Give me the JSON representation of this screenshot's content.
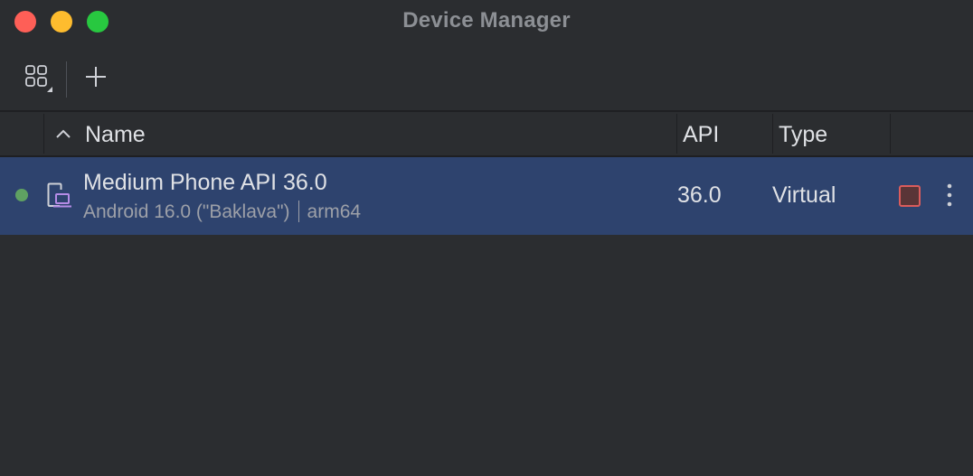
{
  "window": {
    "title": "Device Manager"
  },
  "toolbar": {
    "grid_button_icon": "grid-view-icon",
    "add_button_icon": "plus-icon"
  },
  "table": {
    "columns": {
      "name": "Name",
      "api": "API",
      "type": "Type"
    },
    "sort": "ascending",
    "rows": [
      {
        "status": "running",
        "status_color": "#5fa162",
        "icon": "virtual-phone-icon",
        "name": "Medium Phone API 36.0",
        "os": "Android 16.0 (\"Baklava\")",
        "arch": "arm64",
        "api": "36.0",
        "type": "Virtual",
        "selected": true
      }
    ]
  },
  "colors": {
    "background": "#2b2d30",
    "selection": "#2e436e",
    "stop_accent": "#db5c5c"
  }
}
